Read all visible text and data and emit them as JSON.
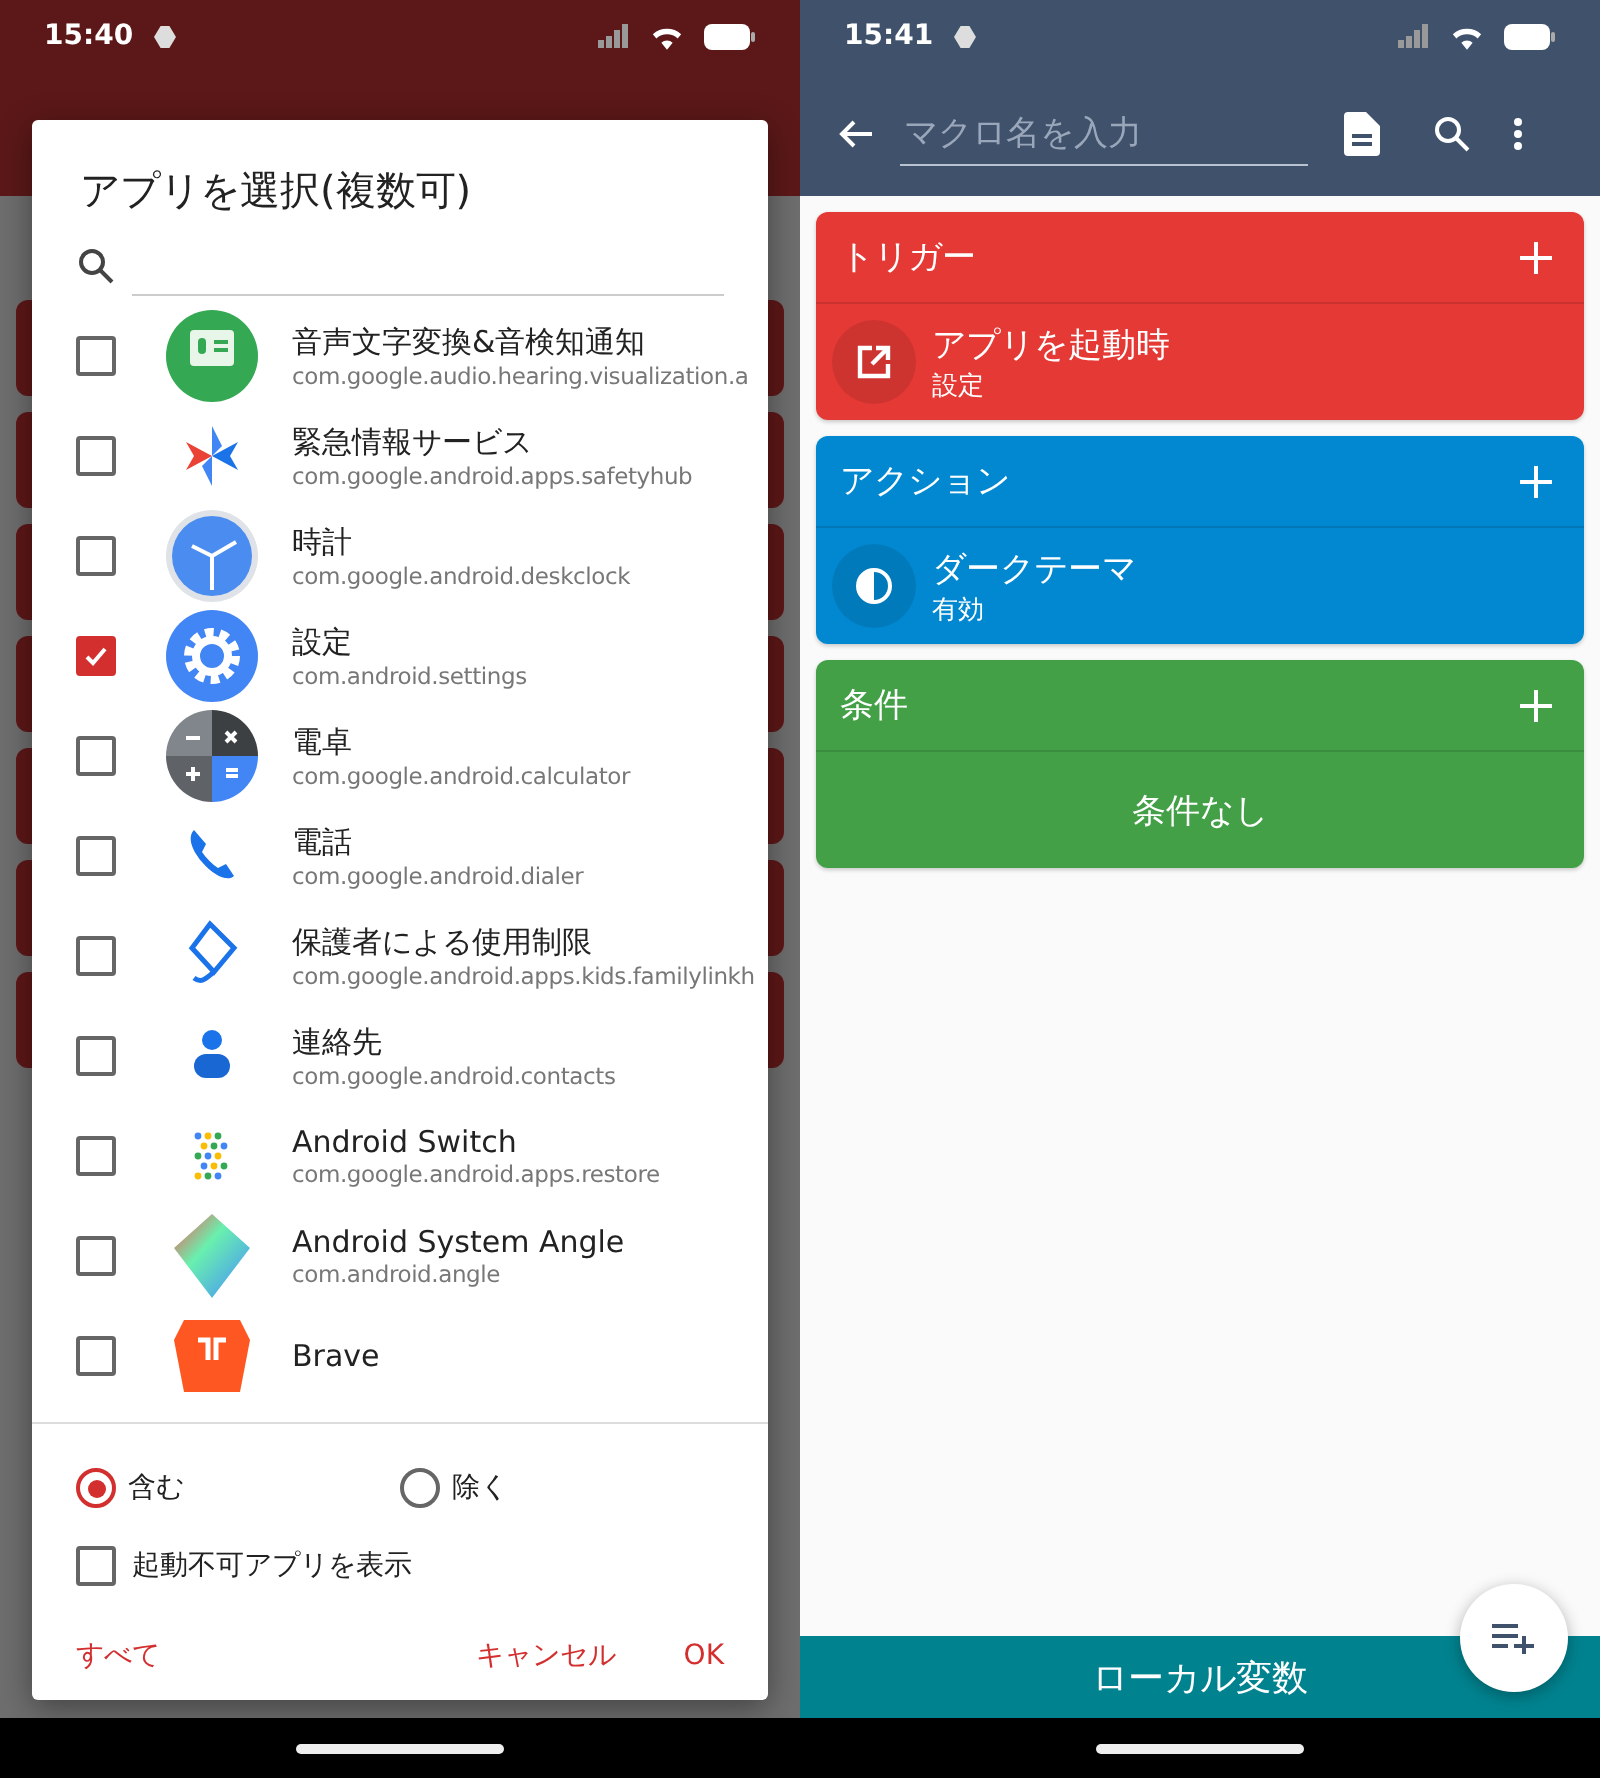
{
  "left": {
    "status_time": "15:40",
    "dialog": {
      "title": "アプリを選択(複数可)",
      "apps": [
        {
          "name": "音声文字変換&音検知通知",
          "package": "com.google.audio.hearing.visualization.a",
          "checked": false
        },
        {
          "name": "緊急情報サービス",
          "package": "com.google.android.apps.safetyhub",
          "checked": false
        },
        {
          "name": "時計",
          "package": "com.google.android.deskclock",
          "checked": false
        },
        {
          "name": "設定",
          "package": "com.android.settings",
          "checked": true
        },
        {
          "name": "電卓",
          "package": "com.google.android.calculator",
          "checked": false
        },
        {
          "name": "電話",
          "package": "com.google.android.dialer",
          "checked": false
        },
        {
          "name": "保護者による使用制限",
          "package": "com.google.android.apps.kids.familylinkh",
          "checked": false
        },
        {
          "name": "連絡先",
          "package": "com.google.android.contacts",
          "checked": false
        },
        {
          "name": "Android Switch",
          "package": "com.google.android.apps.restore",
          "checked": false
        },
        {
          "name": "Android System Angle",
          "package": "com.android.angle",
          "checked": false
        },
        {
          "name": "Brave",
          "checked": false
        }
      ],
      "filter_options": [
        {
          "label": "含む",
          "selected": true
        },
        {
          "label": "除く",
          "selected": false
        }
      ],
      "show_unlaunchable": {
        "label": "起動不可アプリを表示",
        "checked": false
      },
      "buttons": [
        {
          "label": "すべて"
        },
        {
          "label": "キャンセル"
        },
        {
          "label": "OK"
        }
      ]
    }
  },
  "right": {
    "status_time": "15:41",
    "toolbar": {
      "placeholder": "マクロ名を入力"
    },
    "sections": [
      {
        "title": "トリガー",
        "color": "#e53935",
        "items": [
          {
            "title": "アプリを起動時",
            "subtitle": "設定"
          }
        ]
      },
      {
        "title": "アクション",
        "color": "#0288d1",
        "items": [
          {
            "title": "ダークテーマ",
            "subtitle": "有効"
          }
        ]
      },
      {
        "title": "条件",
        "color": "#43a047",
        "empty_text": "条件なし"
      }
    ],
    "bottom_bar": "ローカル変数"
  }
}
